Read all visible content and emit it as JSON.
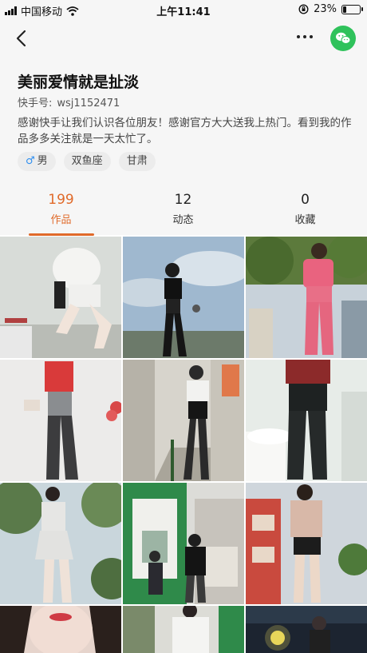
{
  "status_bar": {
    "carrier": "中国移动",
    "time": "上午11:41",
    "battery": "23%",
    "battery_level": 0.23
  },
  "nav": {
    "back_icon": "chevron-left-icon",
    "more_icon": "more-horizontal-icon",
    "wechat_icon": "wechat-icon",
    "wechat_color": "#2fc25b"
  },
  "profile": {
    "name": "美丽爱情就是扯淡",
    "id_label": "快手号:",
    "id_value": "wsj1152471",
    "bio": "感谢快手让我们认识各位朋友！感谢官方大大送我上热门。看到我的作品多多关注就是一天太忙了。",
    "tags": [
      {
        "icon": "male-icon",
        "label": "男"
      },
      {
        "label": "双鱼座"
      },
      {
        "label": "甘肃"
      }
    ]
  },
  "tabs": [
    {
      "count": "199",
      "label": "作品",
      "active": true
    },
    {
      "count": "12",
      "label": "动态",
      "active": false
    },
    {
      "count": "0",
      "label": "收藏",
      "active": false
    }
  ],
  "accent_color": "#e06a2a",
  "grid": {
    "thumbnails": [
      {
        "name": "thumbnail-white-outfit-room"
      },
      {
        "name": "thumbnail-black-outfit-sky"
      },
      {
        "name": "thumbnail-pink-tracksuit-tree"
      },
      {
        "name": "thumbnail-red-top-grey-skirt"
      },
      {
        "name": "thumbnail-stairway-black-skirt"
      },
      {
        "name": "thumbnail-black-leggings-bathroom"
      },
      {
        "name": "thumbnail-white-dress-trees"
      },
      {
        "name": "thumbnail-green-building-street"
      },
      {
        "name": "thumbnail-pink-top-street"
      },
      {
        "name": "thumbnail-face-closeup"
      },
      {
        "name": "thumbnail-white-shirt-outdoor"
      },
      {
        "name": "thumbnail-night-lights"
      }
    ]
  }
}
